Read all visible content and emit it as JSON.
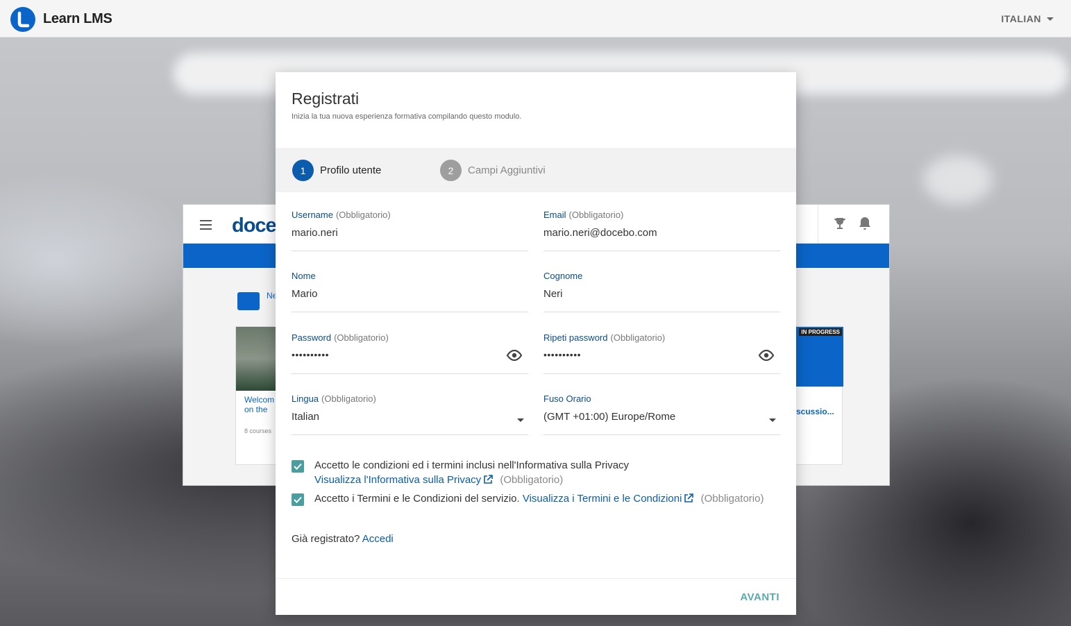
{
  "app": {
    "title": "Learn LMS",
    "language": "ITALIAN"
  },
  "background": {
    "brand": "doce",
    "card_left_title_1": "Welcom",
    "card_left_title_2": "on the",
    "card_left_meta": "8 courses",
    "card_left_heading": "Ne",
    "card_right_tag": "IN PROGRESS",
    "card_right_title": "scussio..."
  },
  "form": {
    "title": "Registrati",
    "subtitle": "Inizia la tua nuova esperienza formativa compilando questo modulo.",
    "steps": [
      {
        "number": "1",
        "label": "Profilo utente"
      },
      {
        "number": "2",
        "label": "Campi Aggiuntivi"
      }
    ],
    "required_text": "(Obbligatorio)",
    "fields": {
      "username": {
        "label": "Username",
        "value": "mario.neri"
      },
      "email": {
        "label": "Email",
        "value": "mario.neri@docebo.com"
      },
      "nome": {
        "label": "Nome",
        "value": "Mario"
      },
      "cognome": {
        "label": "Cognome",
        "value": "Neri"
      },
      "password": {
        "label": "Password",
        "value": "••••••••••"
      },
      "repeat_password": {
        "label": "Ripeti password",
        "value": "••••••••••"
      },
      "lingua": {
        "label": "Lingua",
        "value": "Italian"
      },
      "fuso": {
        "label": "Fuso Orario",
        "value": "(GMT +01:00) Europe/Rome"
      }
    },
    "privacy": {
      "text": "Accetto le condizioni ed i termini inclusi nell'Informativa sulla Privacy",
      "link": "Visualizza l'Informativa sulla Privacy",
      "checked": true
    },
    "terms": {
      "text": "Accetto i Termini e le Condizioni del servizio.",
      "link": "Visualizza i Termini e le Condizioni",
      "checked": true
    },
    "login_prompt": "Già registrato?",
    "login_link": "Accedi",
    "next_button": "AVANTI"
  },
  "colors": {
    "primary": "#0b5cad",
    "teal": "#4a9ea0",
    "label": "#0a4c8c"
  },
  "icons": [
    "logo-icon",
    "chevron-down-icon",
    "eye-icon",
    "external-link-icon",
    "check-icon",
    "trophy-icon",
    "bell-icon",
    "menu-icon"
  ]
}
